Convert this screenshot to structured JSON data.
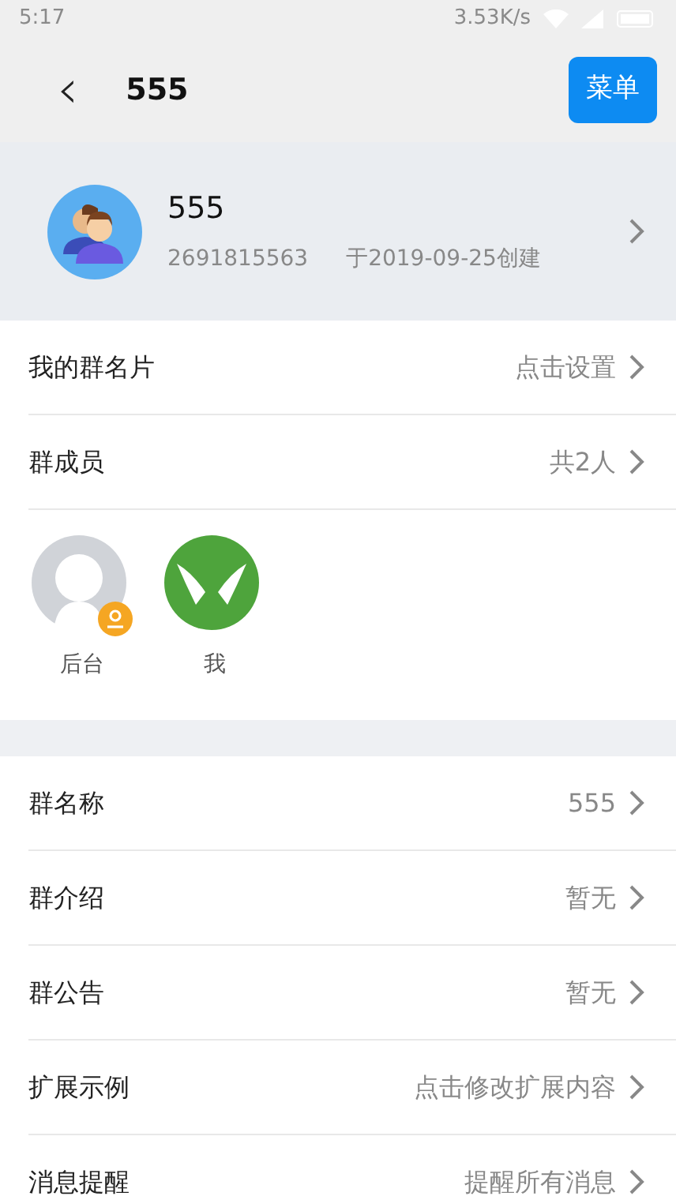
{
  "status_bar": {
    "time": "5:17",
    "speed": "3.53K/s"
  },
  "header": {
    "back": "‹",
    "title": "555",
    "menu_button": "菜单"
  },
  "group": {
    "name": "555",
    "id": "2691815563",
    "created": "于2019-09-25创建"
  },
  "top_rows": [
    {
      "label": "我的群名片",
      "value": "点击设置"
    },
    {
      "label": "群成员",
      "value": "共2人"
    }
  ],
  "members": [
    {
      "name": "后台",
      "kind": "default",
      "owner": true
    },
    {
      "name": "我",
      "kind": "birds",
      "owner": false
    }
  ],
  "settings": [
    {
      "label": "群名称",
      "value": "555"
    },
    {
      "label": "群介绍",
      "value": "暂无"
    },
    {
      "label": "群公告",
      "value": "暂无"
    },
    {
      "label": "扩展示例",
      "value": "点击修改扩展内容"
    },
    {
      "label": "消息提醒",
      "value": "提醒所有消息"
    }
  ]
}
